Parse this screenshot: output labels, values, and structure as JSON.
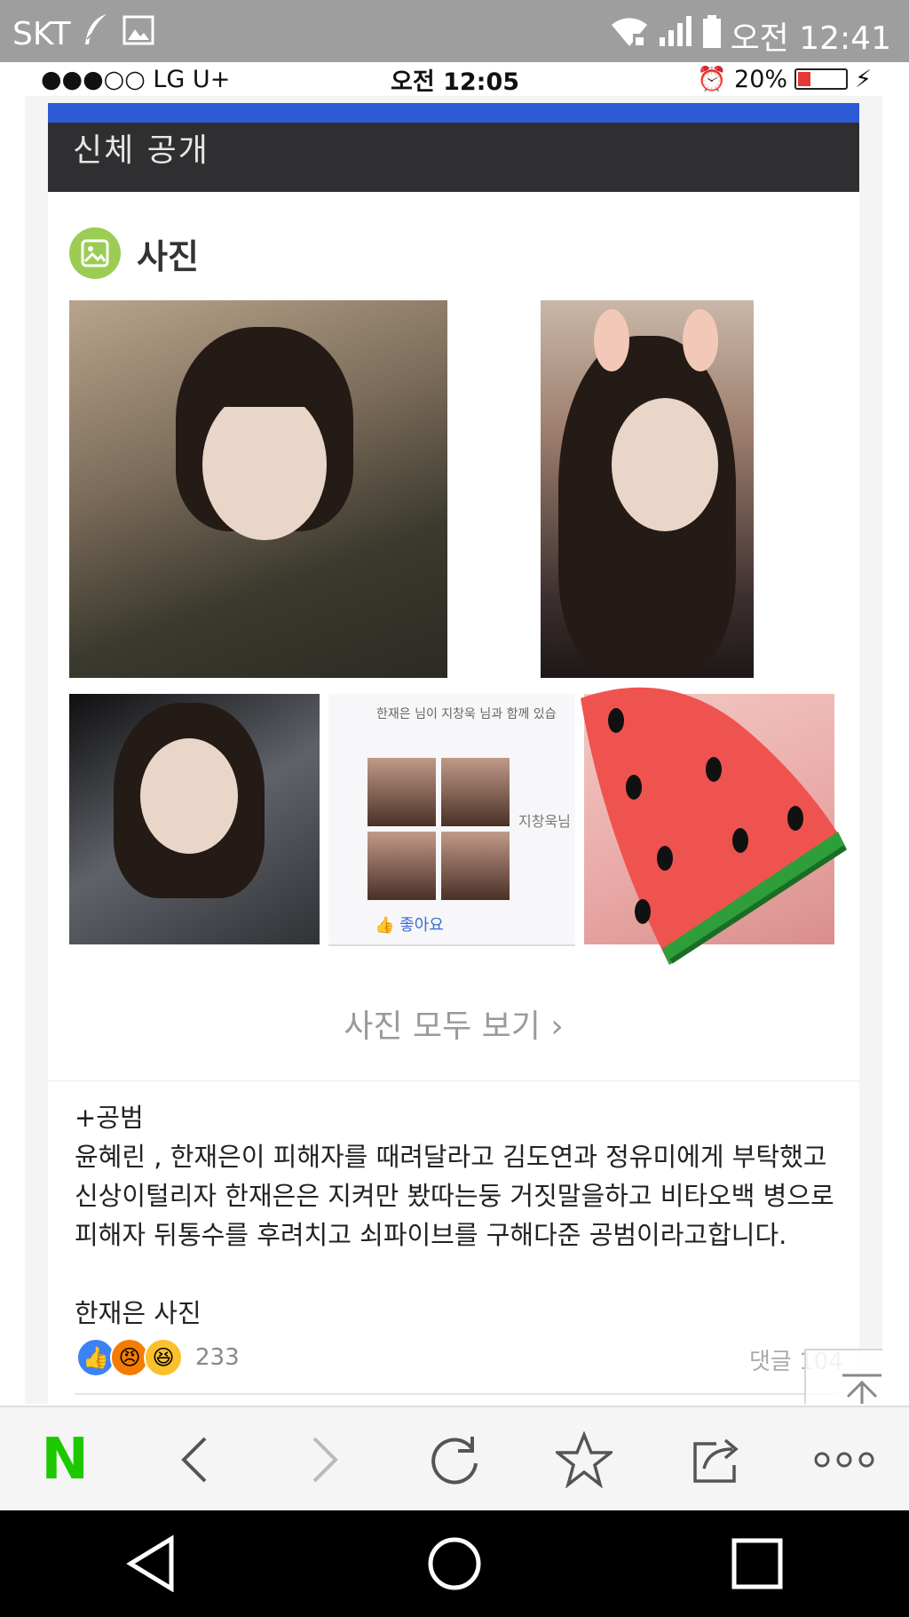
{
  "android_status": {
    "carrier": "SKT",
    "time": "오전 12:41"
  },
  "ios_status": {
    "carrier": "●●●○○ LG U+",
    "time": "오전 12:05",
    "battery": "20%"
  },
  "card": {
    "hero_label": "신체 공개",
    "section_title": "사진",
    "see_all": "사진 모두 보기 ›",
    "photo_overlay": {
      "title_line": "한재은 님이 지창욱 님과 함께 있습",
      "side_name": "지창욱님",
      "like": "좋아요"
    }
  },
  "post": {
    "lines": [
      "+공범",
      "윤혜린 , 한재은이 피해자를 때려달라고 김도연과 정유미에게 부탁했고",
      "신상이털리자 한재은은 지켜만 봤따는둥 거짓말을하고 비타오백 병으로",
      "피해자 뒤통수를 후려치고 쇠파이브를 구해다준 공범이라고합니다."
    ],
    "caption": "한재은 사진",
    "reaction_count": "233",
    "comment_label": "댓글 104"
  },
  "colors": {
    "naver_green": "#1ec800",
    "hero_blue": "#2d5bd6",
    "status_gray": "#9e9e9e"
  }
}
